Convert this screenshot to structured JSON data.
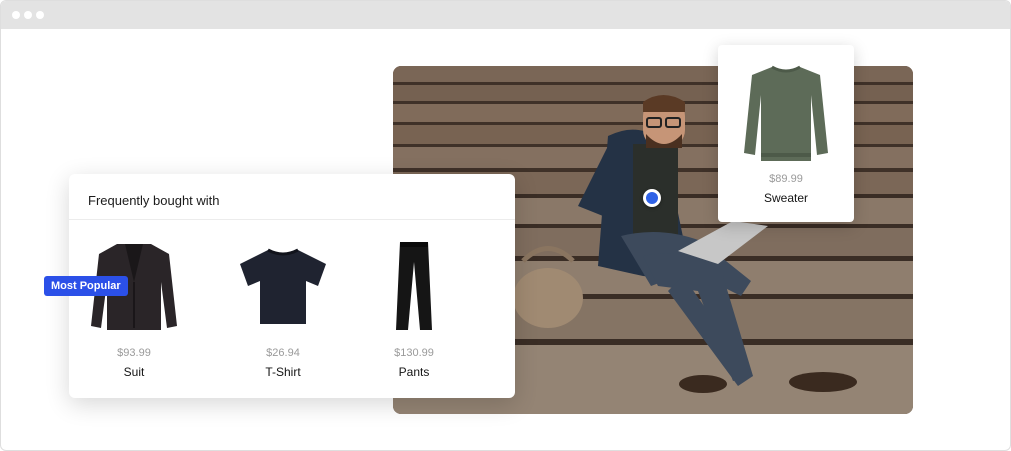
{
  "colors": {
    "accent": "#2b50e8",
    "hotspot": "#2f62e6",
    "price_text": "#9a9a9a"
  },
  "featured_product": {
    "name": "Sweater",
    "price": "$89.99",
    "icon": "sweater-icon"
  },
  "frequently_bought": {
    "title": "Frequently bought with",
    "badge": "Most Popular",
    "items": [
      {
        "name": "Suit",
        "price": "$93.99",
        "icon": "suit-jacket-icon"
      },
      {
        "name": "T-Shirt",
        "price": "$26.94",
        "icon": "tshirt-icon"
      },
      {
        "name": "Pants",
        "price": "$130.99",
        "icon": "pants-icon"
      }
    ]
  }
}
